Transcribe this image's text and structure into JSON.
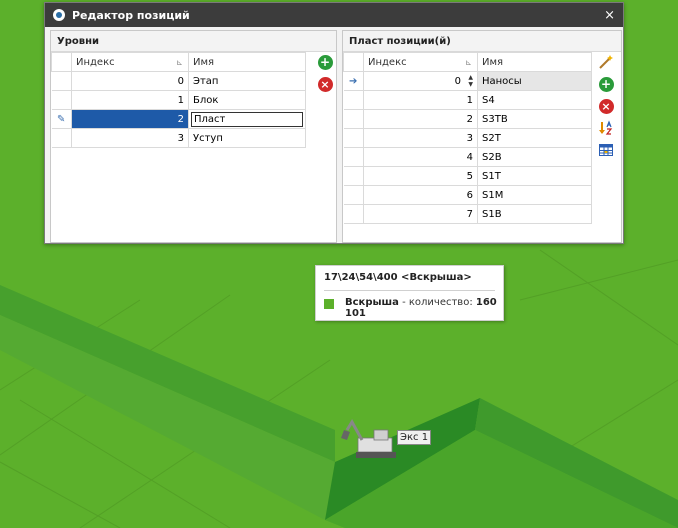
{
  "window": {
    "title": "Редактор позиций",
    "close": "×"
  },
  "levels": {
    "title": "Уровни",
    "columns": [
      "Индекс",
      "Имя"
    ],
    "rows": [
      {
        "index": "0",
        "name": "Этап"
      },
      {
        "index": "1",
        "name": "Блок"
      },
      {
        "index": "2",
        "name": "Пласт"
      },
      {
        "index": "3",
        "name": "Уступ"
      }
    ],
    "selected_index": 2,
    "toolbar": [
      "add-icon",
      "remove-icon"
    ]
  },
  "positions": {
    "title": "Пласт позиции(й)",
    "columns": [
      "Индекс",
      "Имя"
    ],
    "rows": [
      {
        "index": "0",
        "name": "Наносы"
      },
      {
        "index": "1",
        "name": "S4"
      },
      {
        "index": "2",
        "name": "S3TB"
      },
      {
        "index": "3",
        "name": "S2T"
      },
      {
        "index": "4",
        "name": "S2B"
      },
      {
        "index": "5",
        "name": "S1T"
      },
      {
        "index": "6",
        "name": "S1M"
      },
      {
        "index": "7",
        "name": "S1B"
      }
    ],
    "toolbar": [
      "magic-wand-icon",
      "add-icon",
      "remove-icon",
      "sort-az-icon",
      "table-icon"
    ]
  },
  "tooltip": {
    "title": "17\\24\\54\\400 <Вскрыша>",
    "item_name": "Вскрыша",
    "item_text": " - количество: ",
    "item_value": "160 101",
    "swatch_color": "#5cb02b"
  },
  "excavator_label": "Экс 1",
  "colors": {
    "terrain": "#5cb02b",
    "selection": "#1e5aa8",
    "titlebar": "#3c3c3c",
    "trench": "#2f8a22"
  }
}
